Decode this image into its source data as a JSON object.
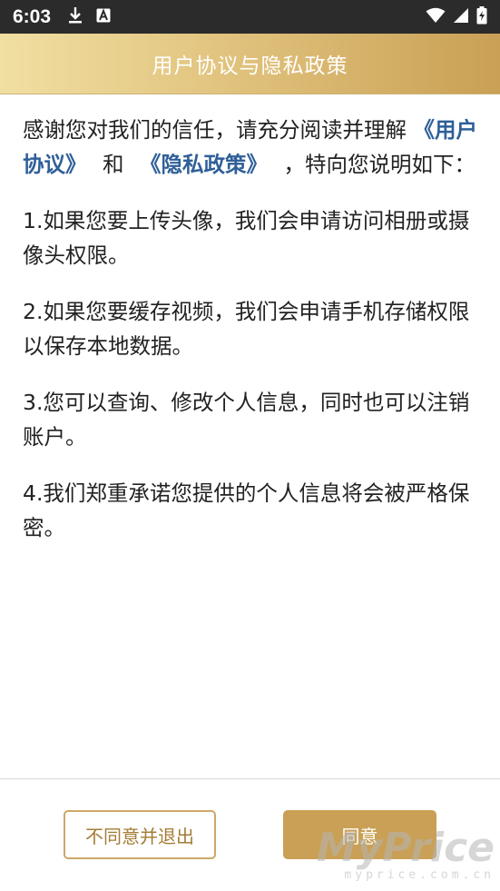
{
  "status_bar": {
    "time": "6:03",
    "left_icons": [
      "download-icon",
      "notification-a-icon"
    ],
    "right_icons": [
      "wifi-icon",
      "signal-icon",
      "battery-charging-icon"
    ]
  },
  "header": {
    "title": "用户协议与隐私政策",
    "gradient_colors": [
      "#f1dfa2",
      "#c9a055"
    ]
  },
  "body": {
    "intro_prefix": "感谢您对我们的信任，请充分阅读并理解",
    "link_user_agreement": "《用户协议》",
    "intro_and": "和",
    "link_privacy_policy": "《隐私政策》",
    "intro_suffix": "，特向您说明如下：",
    "items": [
      "1.如果您要上传头像，我们会申请访问相册或摄像头权限。",
      "2.如果您要缓存视频，我们会申请手机存储权限以保存本地数据。",
      "3.您可以查询、修改个人信息，同时也可以注销账户。",
      "4.我们郑重承诺您提供的个人信息将会被严格保密。"
    ],
    "link_color": "#2f5f98"
  },
  "footer": {
    "disagree_label": "不同意并退出",
    "agree_label": "同意",
    "accent_color": "#c9a055"
  },
  "watermark": {
    "brand": "MyPrice",
    "domain": "myprice.com.cn"
  }
}
